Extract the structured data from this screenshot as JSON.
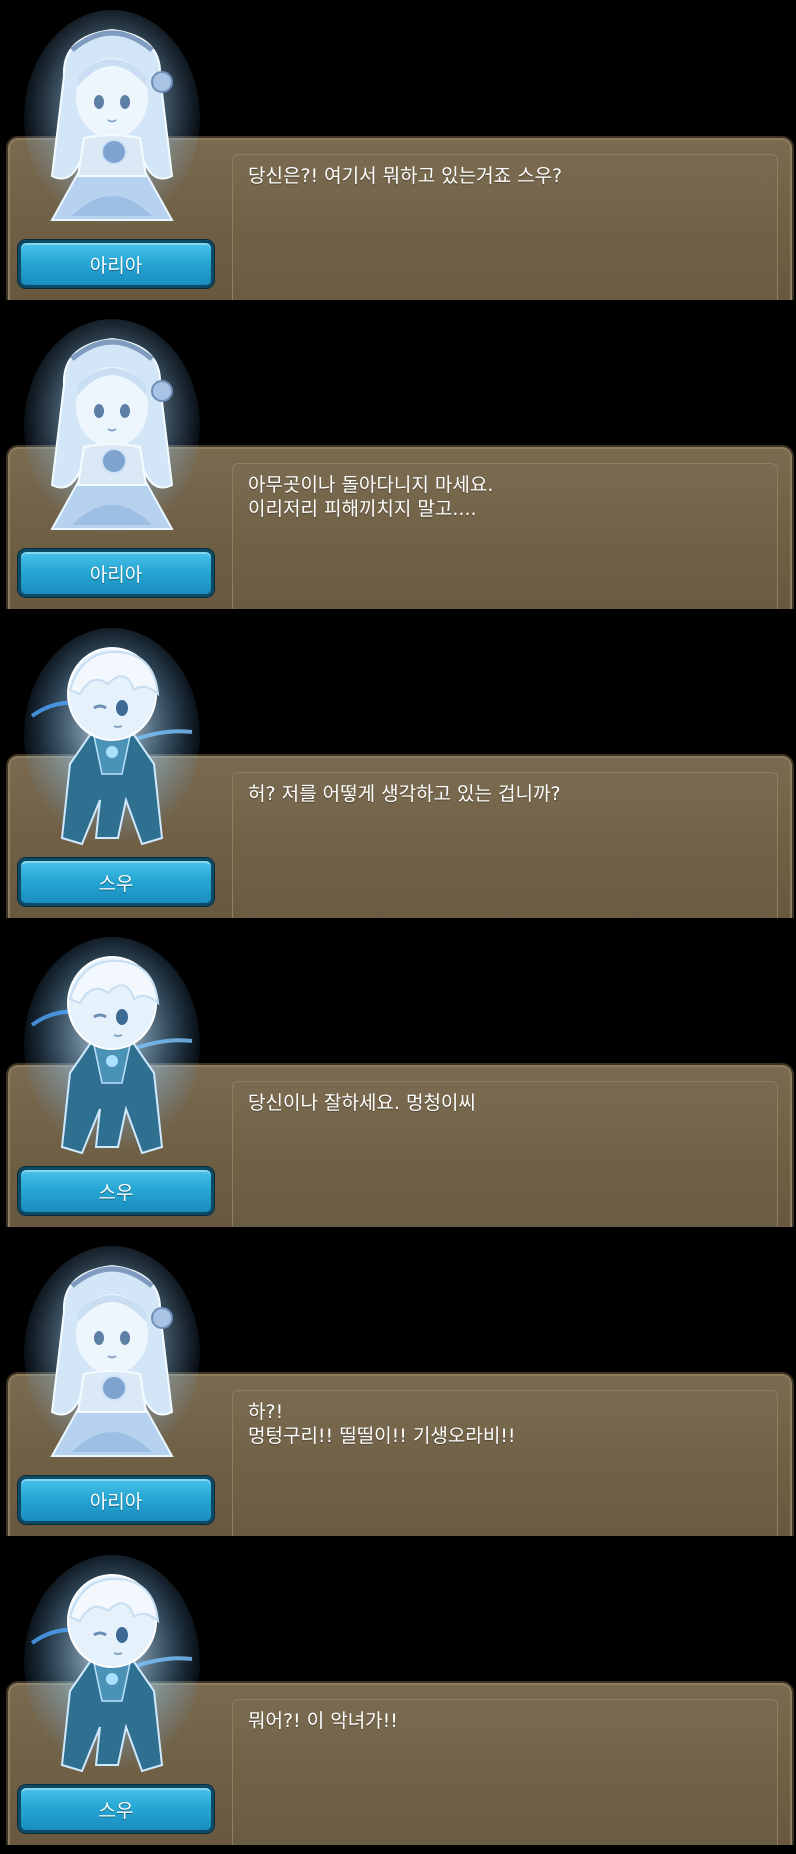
{
  "panels": [
    {
      "speaker": "아리아",
      "character": "aria",
      "text": "당신은?! 여기서 뭐하고 있는거죠 스우?"
    },
    {
      "speaker": "아리아",
      "character": "aria",
      "text": "아무곳이나 돌아다니지 마세요.\n이리저리 피해끼치지 말고...."
    },
    {
      "speaker": "스우",
      "character": "swoo",
      "text": "허? 저를 어떻게 생각하고 있는 겁니까?"
    },
    {
      "speaker": "스우",
      "character": "swoo",
      "text": "당신이나 잘하세요. 멍청이씨"
    },
    {
      "speaker": "아리아",
      "character": "aria",
      "text": "하?!\n멍텅구리!! 띨띨이!! 기생오라비!!"
    },
    {
      "speaker": "스우",
      "character": "swoo",
      "text": "뭐어?! 이 악녀가!!"
    }
  ],
  "colors": {
    "box": "#6f5f44",
    "name_button": "#27a7d4",
    "glow": "#bfe6ff"
  }
}
